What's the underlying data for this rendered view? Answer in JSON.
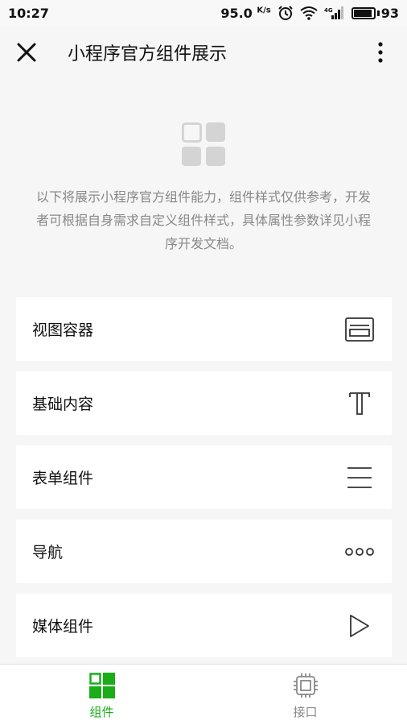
{
  "status_bar": {
    "time": "10:27",
    "speed_value": "95.0",
    "speed_unit": "K/s",
    "battery": "93"
  },
  "nav": {
    "title": "小程序官方组件展示",
    "close_icon": "close-icon",
    "more_icon": "more-vertical-icon"
  },
  "header": {
    "logo_icon": "component-grid-logo",
    "description": "以下将展示小程序官方组件能力，组件样式仅供参考，开发者可根据自身需求自定义组件样式，具体属性参数详见小程序开发文档。"
  },
  "menu": [
    {
      "label": "视图容器",
      "icon": "view-container-icon"
    },
    {
      "label": "基础内容",
      "icon": "text-t-icon"
    },
    {
      "label": "表单组件",
      "icon": "lines-icon"
    },
    {
      "label": "导航",
      "icon": "dots-icon"
    },
    {
      "label": "媒体组件",
      "icon": "play-icon"
    }
  ],
  "tabs": [
    {
      "label": "组件",
      "icon": "components-grid-icon",
      "active": true
    },
    {
      "label": "接口",
      "icon": "chip-icon",
      "active": false
    }
  ],
  "colors": {
    "accent": "#1aad19",
    "muted": "#888888",
    "background": "#f6f6f6",
    "icon_gray": "#d4d4d4"
  }
}
